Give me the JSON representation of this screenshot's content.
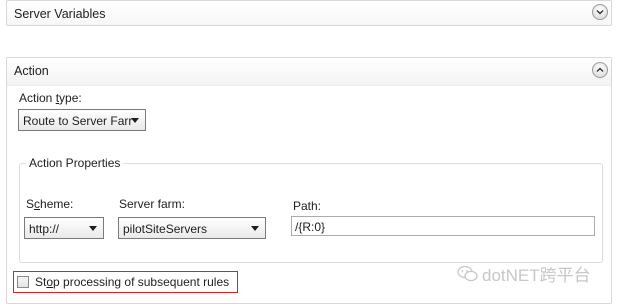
{
  "server_variables": {
    "title": "Server Variables"
  },
  "action": {
    "title": "Action",
    "action_type": {
      "label_pre": "Action ",
      "label_accel": "t",
      "label_post": "ype:",
      "value": "Route to Server Farr"
    },
    "properties": {
      "legend": "Action Properties",
      "scheme": {
        "label_pre": "S",
        "label_accel": "c",
        "label_post": "heme:",
        "value": "http://"
      },
      "server_farm": {
        "label": "Server farm:",
        "value": "pilotSiteServers"
      },
      "path": {
        "label": "Path:",
        "value": "/{R:0}"
      }
    },
    "stop_processing": {
      "label_pre": "St",
      "label_accel": "o",
      "label_post": "p processing of subsequent rules",
      "checked": false
    }
  },
  "watermark": {
    "text": "dotNET跨平台"
  },
  "icons": [
    "chevron-down-icon",
    "chevron-up-icon",
    "wechat-icon"
  ],
  "colors": {
    "highlight_border": "#e02020",
    "panel_border": "#d8d8d8"
  }
}
